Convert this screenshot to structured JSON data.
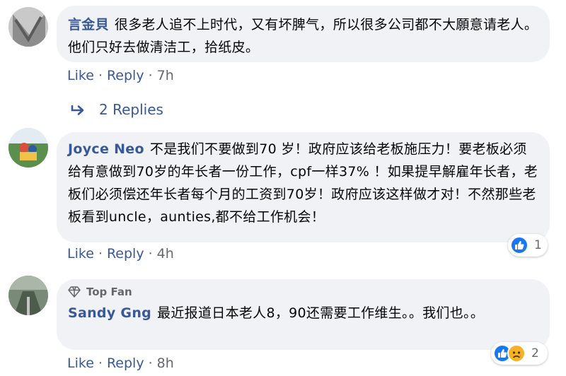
{
  "comments": [
    {
      "author": "言金貝",
      "text": "很多老人追不上时代，又有坏脾气，所以很多公司都不大願意请老人。他们只好去做清洁工，拾纸皮。",
      "actions": {
        "like": "Like",
        "reply": "Reply",
        "time": "7h"
      },
      "replies_label": "2 Replies"
    },
    {
      "author": "Joyce Neo",
      "text": "不是我们不要做到70 岁！政府应该给老板施压力！要老板必须给有意做到70岁的年长者一份工作，cpf一样37% ！如果提早解雇年长者，老板们必须偿还年长者每个月的工资到70岁！政府应该这样做才对！不然那些老板看到uncle，aunties,都不给工作机会！",
      "actions": {
        "like": "Like",
        "reply": "Reply",
        "time": "4h"
      },
      "reactions": {
        "icons": [
          "like-icon"
        ],
        "count": "1"
      }
    },
    {
      "badge": "Top Fan",
      "author": "Sandy Gng",
      "text": "最近报道日本老人8，90还需要工作维生。。我们也。。",
      "actions": {
        "like": "Like",
        "reply": "Reply",
        "time": "8h"
      },
      "reactions": {
        "icons": [
          "like-icon",
          "sad-icon"
        ],
        "count": "2"
      }
    }
  ],
  "separator": "·",
  "colors": {
    "link": "#385898",
    "meta": "#65676b",
    "bubble": "#f0f2f5",
    "like": "#1877f2",
    "sad": "#f7b125"
  }
}
